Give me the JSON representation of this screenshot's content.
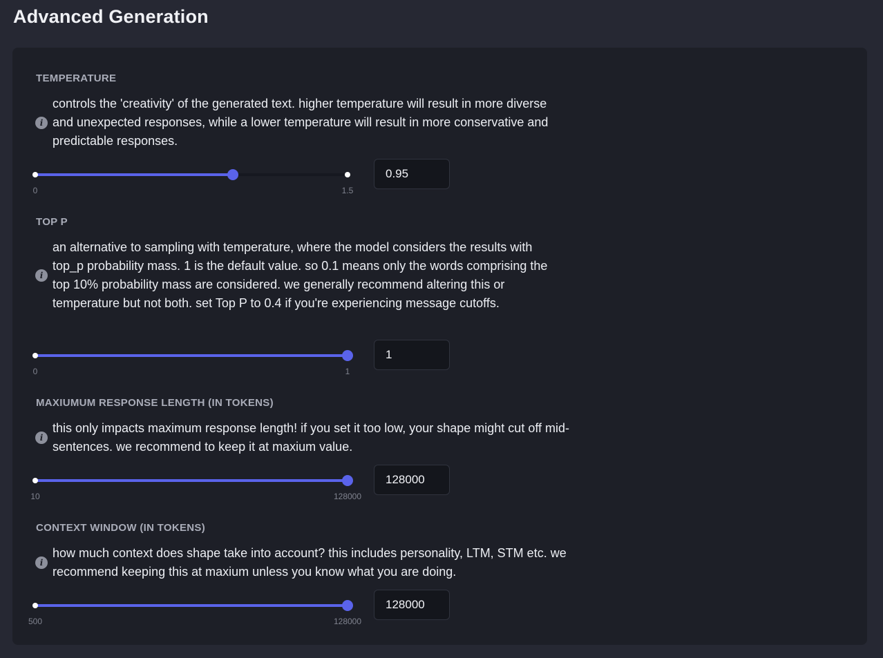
{
  "page": {
    "title": "Advanced Generation"
  },
  "colors": {
    "accent": "#5a63ea",
    "panel": "#1d1f27",
    "background": "#262833"
  },
  "settings": [
    {
      "label": "TEMPERATURE",
      "description": "controls the 'creativity' of the generated text. higher temperature will result in more diverse and unexpected responses, while a lower temperature will result in more conservative and predictable responses.",
      "min_label": "0",
      "max_label": "1.5",
      "min": 0,
      "max": 1.5,
      "value": 0.95,
      "value_text": "0.95",
      "icon": "info-icon"
    },
    {
      "label": "TOP P",
      "description": "an alternative to sampling with temperature, where the model considers the results with top_p probability mass. 1 is the default value. so 0.1 means only the words comprising the top 10% probability mass are considered. we generally recommend altering this or temperature but not both. set Top P to 0.4 if you're experiencing message cutoffs.",
      "min_label": "0",
      "max_label": "1",
      "min": 0,
      "max": 1,
      "value": 1,
      "value_text": "1",
      "icon": "info-icon"
    },
    {
      "label": "MAXIUMUM RESPONSE LENGTH (IN TOKENS)",
      "description": "this only impacts maximum response length! if you set it too low, your shape might cut off mid-sentences. we recommend to keep it at maxium value.",
      "min_label": "10",
      "max_label": "128000",
      "min": 10,
      "max": 128000,
      "value": 128000,
      "value_text": "128000",
      "icon": "info-icon"
    },
    {
      "label": "CONTEXT WINDOW (IN TOKENS)",
      "description": "how much context does shape take into account? this includes personality, LTM, STM etc. we recommend keeping this at maxium unless you know what you are doing.",
      "min_label": "500",
      "max_label": "128000",
      "min": 500,
      "max": 128000,
      "value": 128000,
      "value_text": "128000",
      "icon": "info-icon"
    }
  ]
}
